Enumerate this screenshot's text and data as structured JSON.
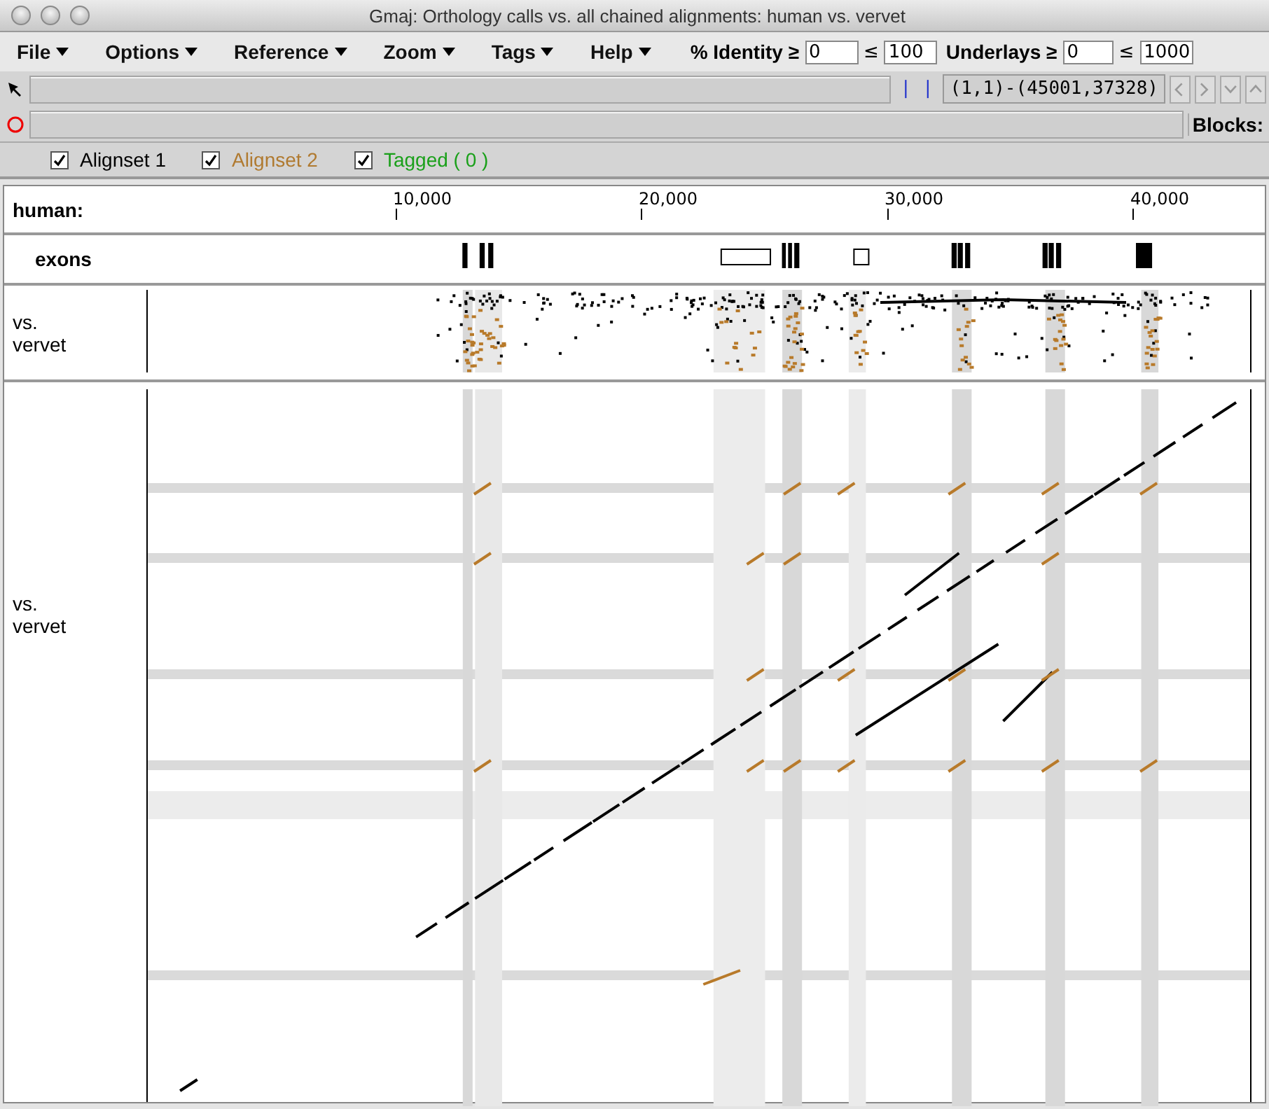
{
  "window": {
    "title": "Gmaj: Orthology calls vs. all chained alignments: human vs. vervet"
  },
  "menus": [
    {
      "label": "File"
    },
    {
      "label": "Options"
    },
    {
      "label": "Reference"
    },
    {
      "label": "Zoom"
    },
    {
      "label": "Tags"
    },
    {
      "label": "Help"
    }
  ],
  "filters": [
    {
      "label": "% Identity ≥",
      "min": "0",
      "le": "≤",
      "max": "100"
    },
    {
      "label": "Underlays ≥",
      "min": "0",
      "le": "≤",
      "max": "1000"
    }
  ],
  "position": {
    "divider": "| |",
    "range": "(1,1)-(45001,37328)"
  },
  "blocks_label": "Blocks:",
  "alignsets": [
    {
      "label": "Alignset 1",
      "checked": true,
      "color": "#000000"
    },
    {
      "label": "Alignset 2",
      "checked": true,
      "color": "#b07a30"
    },
    {
      "label": "Tagged  ( 0 )",
      "checked": true,
      "color": "#1aa01a"
    }
  ],
  "ruler": {
    "label": "human:",
    "ticks": [
      "10,000",
      "20,000",
      "30,000",
      "40,000"
    ]
  },
  "exons_label": "exons",
  "pip_label": "vs. vervet",
  "dotplot_label": "vs. vervet"
}
